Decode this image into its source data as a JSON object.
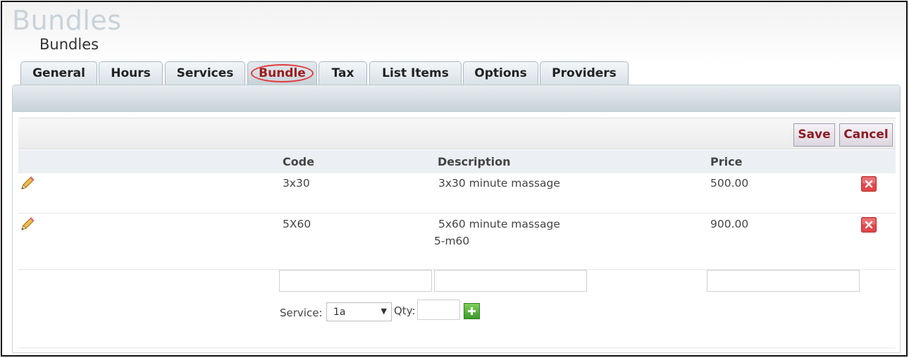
{
  "header": {
    "app_title": "Bundles",
    "page_subtitle": "Bundles"
  },
  "tabs": [
    {
      "label": "General",
      "active": false
    },
    {
      "label": "Hours",
      "active": false
    },
    {
      "label": "Services",
      "active": false
    },
    {
      "label": "Bundle",
      "active": true
    },
    {
      "label": "Tax",
      "active": false
    },
    {
      "label": "List Items",
      "active": false
    },
    {
      "label": "Options",
      "active": false
    },
    {
      "label": "Providers",
      "active": false
    }
  ],
  "toolbar": {
    "save_label": "Save",
    "cancel_label": "Cancel"
  },
  "grid": {
    "columns": {
      "code": "Code",
      "description": "Description",
      "price": "Price"
    },
    "rows": [
      {
        "code": "3x30",
        "description": "3x30 minute massage",
        "sub": "",
        "price": "500.00"
      },
      {
        "code": "5X60",
        "description": "5x60 minute massage",
        "sub": "5-m60",
        "price": "900.00"
      }
    ]
  },
  "new_row": {
    "code_value": "",
    "description_value": "",
    "price_value": "",
    "service_label": "Service:",
    "service_selected": "1a",
    "qty_label": "Qty:",
    "qty_value": ""
  },
  "icons": {
    "edit": "pencil-icon",
    "delete": "delete-x-icon",
    "add": "plus-icon"
  },
  "colors": {
    "accent_text": "#8e1b25",
    "highlight_circle": "#e23a3a",
    "delete_red": "#e0464a",
    "add_green": "#4aa933"
  }
}
